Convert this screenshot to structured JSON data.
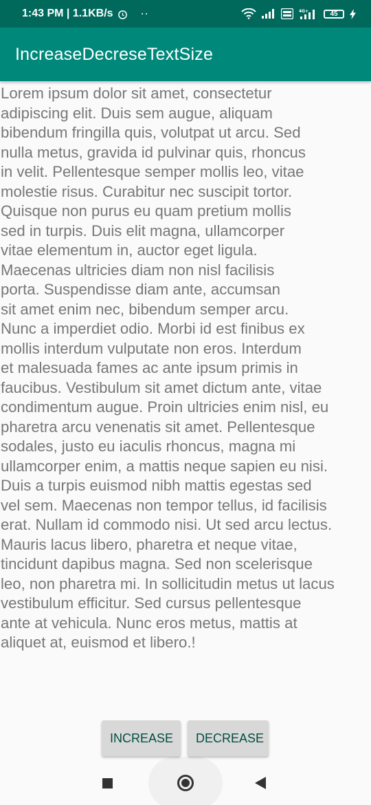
{
  "status_bar": {
    "time_speed": "1:43 PM | 1.1KB/s",
    "dots": "··",
    "battery": "45",
    "icons": [
      "alarm-icon",
      "wifi-icon",
      "signal-icon",
      "volte-icon",
      "4g-signal-icon",
      "battery-icon",
      "charging-icon"
    ]
  },
  "app_bar": {
    "title": "IncreaseDecreseTextSize"
  },
  "content": {
    "lorem_text": "Lorem ipsum dolor sit amet, consectetur\nadipiscing elit. Duis sem augue, aliquam\nbibendum fringilla quis, volutpat ut arcu. Sed\nnulla metus, gravida id pulvinar quis, rhoncus\nin velit. Pellentesque semper mollis leo, vitae\nmolestie risus. Curabitur nec suscipit tortor.\nQuisque non purus eu quam pretium mollis\nsed in turpis. Duis elit magna, ullamcorper\nvitae elementum in, auctor eget ligula.\nMaecenas ultricies diam non nisl facilisis\nporta. Suspendisse diam ante, accumsan\nsit amet enim nec, bibendum semper arcu.\nNunc a imperdiet odio. Morbi id est finibus ex\nmollis interdum vulputate non eros. Interdum\net malesuada fames ac ante ipsum primis in\nfaucibus. Vestibulum sit amet dictum ante, vitae\ncondimentum augue. Proin ultricies enim nisl, eu\npharetra arcu venenatis sit amet. Pellentesque\nsodales, justo eu iaculis rhoncus, magna mi\nullamcorper enim, a mattis neque sapien eu nisi.\nDuis a turpis euismod nibh mattis egestas sed\nvel sem. Maecenas non tempor tellus, id facilisis\nerat. Nullam id commodo nisi. Ut sed arcu lectus.\nMauris lacus libero, pharetra et neque vitae,\ntincidunt dapibus magna. Sed non scelerisque\nleo, non pharetra mi. In sollicitudin metus ut lacus\nvestibulum efficitur. Sed cursus pellentesque\nante at vehicula. Nunc eros metus, mattis at\naliquet at, euismod et libero.!"
  },
  "buttons": {
    "increase_label": "INCREASE",
    "decrease_label": "DECREASE"
  },
  "colors": {
    "status_bar": "#00695c",
    "app_bar": "#00897b",
    "button_text": "#004d40",
    "body_text": "#777777"
  }
}
